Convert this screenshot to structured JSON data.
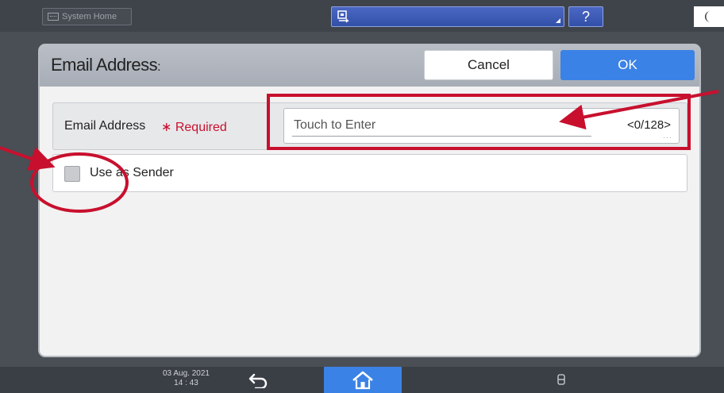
{
  "topbar": {
    "system_home_label": "System Home",
    "help_label": "?"
  },
  "dialog": {
    "title": "Email Address",
    "title_suffix": ":",
    "cancel_label": "Cancel",
    "ok_label": "OK",
    "email_row": {
      "label": "Email Address",
      "required_label": "∗ Required",
      "placeholder": "Touch to Enter",
      "char_count": "<0/128>"
    },
    "sender_row": {
      "label": "Use as Sender",
      "checked": false
    }
  },
  "bottombar": {
    "date": "03 Aug. 2021",
    "time": "14 : 43"
  },
  "colors": {
    "accent_blue": "#3b82e6",
    "annotation_red": "#c8102e",
    "required_red": "#c8102e"
  },
  "icons": [
    "grid-icon",
    "app-switch-icon",
    "help-icon",
    "moon-icon",
    "back-arrow-icon",
    "home-icon",
    "storage-icon"
  ]
}
